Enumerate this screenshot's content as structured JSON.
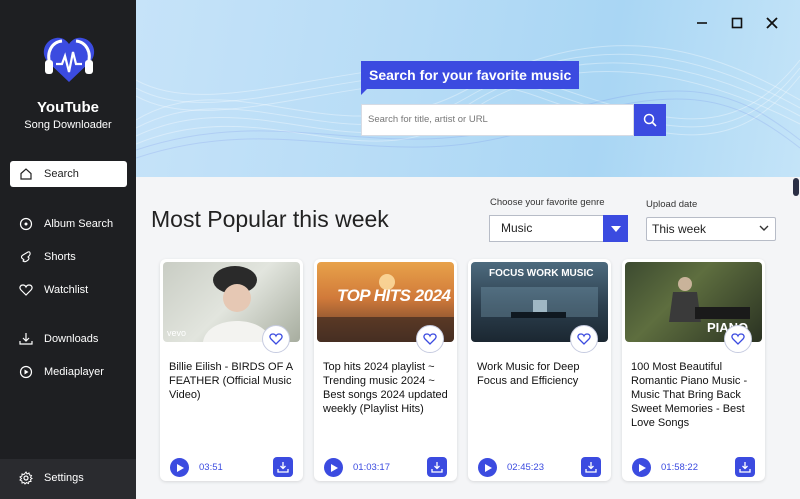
{
  "app": {
    "title": "YouTube",
    "subtitle": "Song Downloader"
  },
  "sidebar": {
    "items": [
      {
        "label": "Search",
        "icon": "home-icon"
      },
      {
        "label": "Album Search",
        "icon": "album-icon"
      },
      {
        "label": "Shorts",
        "icon": "shorts-icon"
      },
      {
        "label": "Watchlist",
        "icon": "heart-icon"
      },
      {
        "label": "Downloads",
        "icon": "download-icon"
      },
      {
        "label": "Mediaplayer",
        "icon": "play-circle-icon"
      },
      {
        "label": "Settings",
        "icon": "gear-icon"
      }
    ]
  },
  "header": {
    "search_title": "Search for your favorite music",
    "search_placeholder": "Search for title, artist or URL"
  },
  "main": {
    "section_title": "Most Popular this week",
    "genre_label": "Choose your favorite genre",
    "genre_value": "Music",
    "upload_label": "Upload date",
    "upload_value": "This week",
    "cards": [
      {
        "title": "Billie Eilish - BIRDS OF A FEATHER (Official Music Video)",
        "duration": "03:51",
        "thumb_text": "vevo"
      },
      {
        "title": "Top hits 2024 playlist ~ Trending music 2024 ~ Best songs 2024 updated weekly (Playlist Hits)",
        "duration": "01:03:17",
        "thumb_text": "TOP HITS 2024"
      },
      {
        "title": "Work Music for Deep Focus and Efficiency",
        "duration": "02:45:23",
        "thumb_text": "FOCUS WORK MUSIC"
      },
      {
        "title": "100 Most Beautiful Romantic Piano Music - Music That Bring Back Sweet Memories - Best Love Songs",
        "duration": "01:58:22",
        "thumb_text": "PIANO"
      }
    ]
  },
  "colors": {
    "accent": "#3b4be0",
    "sidebar": "#1e1f22"
  }
}
